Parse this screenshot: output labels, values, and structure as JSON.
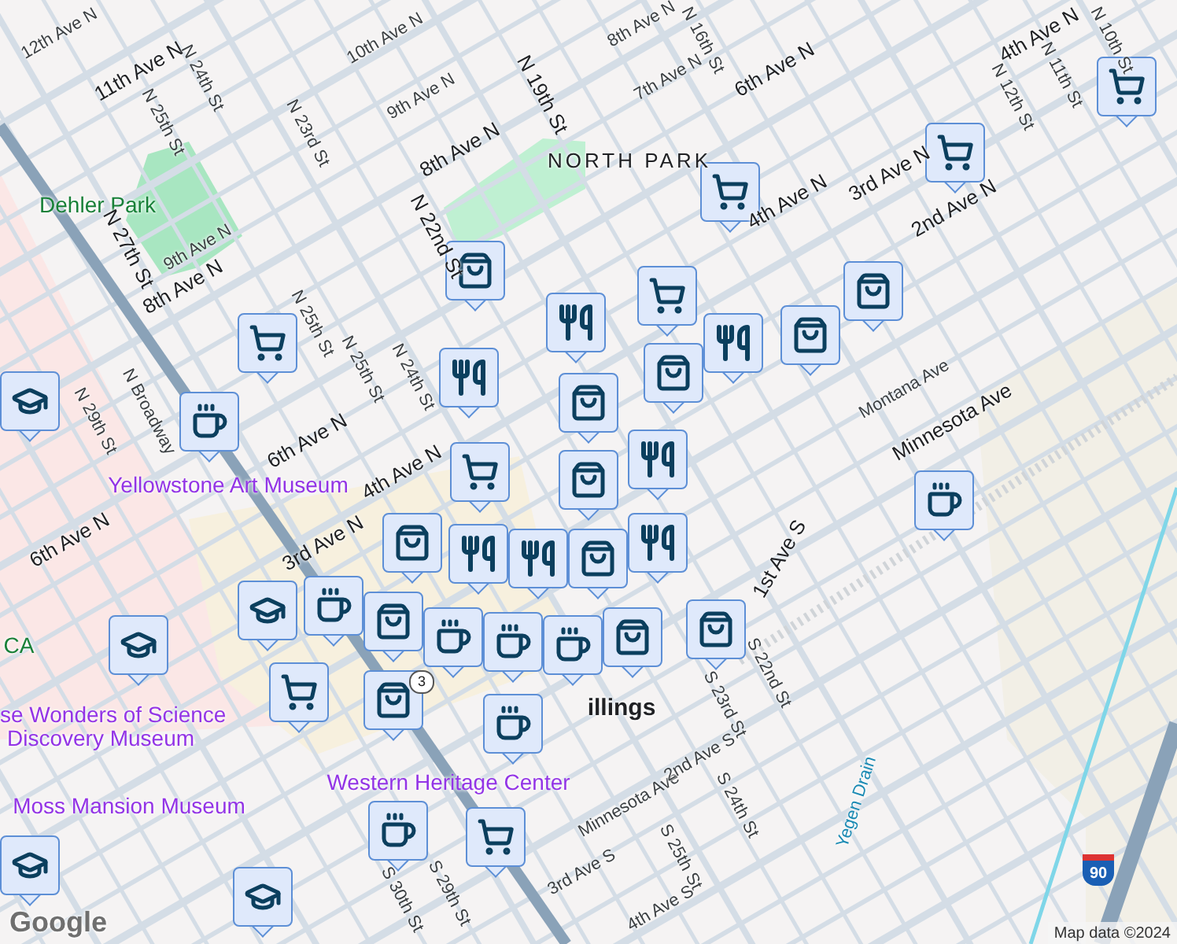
{
  "map": {
    "labels": [
      {
        "text": "12th Ave N",
        "kind": "street"
      },
      {
        "text": "11th Ave N",
        "kind": "major"
      },
      {
        "text": "N 24th St",
        "kind": "street"
      },
      {
        "text": "N 25th St",
        "kind": "street"
      },
      {
        "text": "10th Ave N",
        "kind": "street"
      },
      {
        "text": "9th Ave N",
        "kind": "street"
      },
      {
        "text": "N 23rd St",
        "kind": "street"
      },
      {
        "text": "N 19th St",
        "kind": "major"
      },
      {
        "text": "8th Ave N",
        "kind": "major"
      },
      {
        "text": "N 22nd St",
        "kind": "major"
      },
      {
        "text": "Dehler Park",
        "kind": "park"
      },
      {
        "text": "N 27th St",
        "kind": "major"
      },
      {
        "text": "9th Ave N",
        "kind": "street"
      },
      {
        "text": "8th Ave N",
        "kind": "major"
      },
      {
        "text": "N 25th St",
        "kind": "street"
      },
      {
        "text": "6th Ave N",
        "kind": "major"
      },
      {
        "text": "N 25th St",
        "kind": "street"
      },
      {
        "text": "N 24th St",
        "kind": "street"
      },
      {
        "text": "N 29th St",
        "kind": "street"
      },
      {
        "text": "N Broadway",
        "kind": "street"
      },
      {
        "text": "8th Ave N",
        "kind": "street"
      },
      {
        "text": "7th Ave N",
        "kind": "street"
      },
      {
        "text": "N 16th St",
        "kind": "street"
      },
      {
        "text": "6th Ave N",
        "kind": "major"
      },
      {
        "text": "NORTH PARK",
        "kind": "district"
      },
      {
        "text": "4th Ave N",
        "kind": "major"
      },
      {
        "text": "3rd Ave N",
        "kind": "major"
      },
      {
        "text": "2nd Ave N",
        "kind": "major"
      },
      {
        "text": "4th Ave N",
        "kind": "major"
      },
      {
        "text": "N 12th St",
        "kind": "street"
      },
      {
        "text": "N 11th St",
        "kind": "street"
      },
      {
        "text": "N 10th St",
        "kind": "street"
      },
      {
        "text": "Montana Ave",
        "kind": "street"
      },
      {
        "text": "Minnesota Ave",
        "kind": "major"
      },
      {
        "text": "Yellowstone Art Museum",
        "kind": "poi"
      },
      {
        "text": "4th Ave N",
        "kind": "major"
      },
      {
        "text": "3rd Ave N",
        "kind": "major"
      },
      {
        "text": "6th Ave N",
        "kind": "major"
      },
      {
        "text": "CA",
        "kind": "park"
      },
      {
        "text": "illings",
        "kind": "city"
      },
      {
        "text": "1st Ave S",
        "kind": "major"
      },
      {
        "text": "se Wonders of Science",
        "kind": "poi"
      },
      {
        "text": "Discovery Museum",
        "kind": "poi"
      },
      {
        "text": "Minnesota Ave",
        "kind": "street"
      },
      {
        "text": "Western Heritage Center",
        "kind": "poi"
      },
      {
        "text": "2nd Ave S",
        "kind": "street"
      },
      {
        "text": "S 22nd St",
        "kind": "street"
      },
      {
        "text": "S 23rd St",
        "kind": "street"
      },
      {
        "text": "S 24th St",
        "kind": "street"
      },
      {
        "text": "Moss Mansion Museum",
        "kind": "poi"
      },
      {
        "text": "S 25th St",
        "kind": "street"
      },
      {
        "text": "3rd Ave S",
        "kind": "street"
      },
      {
        "text": "Yegen Drain",
        "kind": "water"
      },
      {
        "text": "4th Ave S",
        "kind": "street"
      },
      {
        "text": "S 29th St",
        "kind": "street"
      },
      {
        "text": "S 30th St",
        "kind": "street"
      }
    ],
    "markers": [
      {
        "kind": "cart"
      },
      {
        "kind": "cart"
      },
      {
        "kind": "cart"
      },
      {
        "kind": "cart"
      },
      {
        "kind": "bag"
      },
      {
        "kind": "fork"
      },
      {
        "kind": "fork"
      },
      {
        "kind": "bag"
      },
      {
        "kind": "bag"
      },
      {
        "kind": "cart"
      },
      {
        "kind": "fork"
      },
      {
        "kind": "cap"
      },
      {
        "kind": "cup"
      },
      {
        "kind": "bag"
      },
      {
        "kind": "bag"
      },
      {
        "kind": "fork"
      },
      {
        "kind": "bag"
      },
      {
        "kind": "fork"
      },
      {
        "kind": "bag"
      },
      {
        "kind": "cart"
      },
      {
        "kind": "fork"
      },
      {
        "kind": "bag"
      },
      {
        "kind": "cup"
      },
      {
        "kind": "bag"
      },
      {
        "kind": "fork"
      },
      {
        "kind": "cup"
      },
      {
        "kind": "cap"
      },
      {
        "kind": "cup"
      },
      {
        "kind": "cart"
      },
      {
        "kind": "bag"
      },
      {
        "kind": "cup"
      },
      {
        "kind": "bag"
      },
      {
        "kind": "cup"
      },
      {
        "kind": "bag"
      },
      {
        "kind": "cap"
      },
      {
        "kind": "cup"
      },
      {
        "kind": "cup"
      },
      {
        "kind": "cart"
      },
      {
        "kind": "cap"
      },
      {
        "kind": "cap"
      }
    ],
    "shields": [
      {
        "text": "3",
        "kind": "state"
      },
      {
        "text": "90",
        "kind": "interstate"
      }
    ],
    "logo": "Google",
    "attribution": "Map data ©2024"
  }
}
